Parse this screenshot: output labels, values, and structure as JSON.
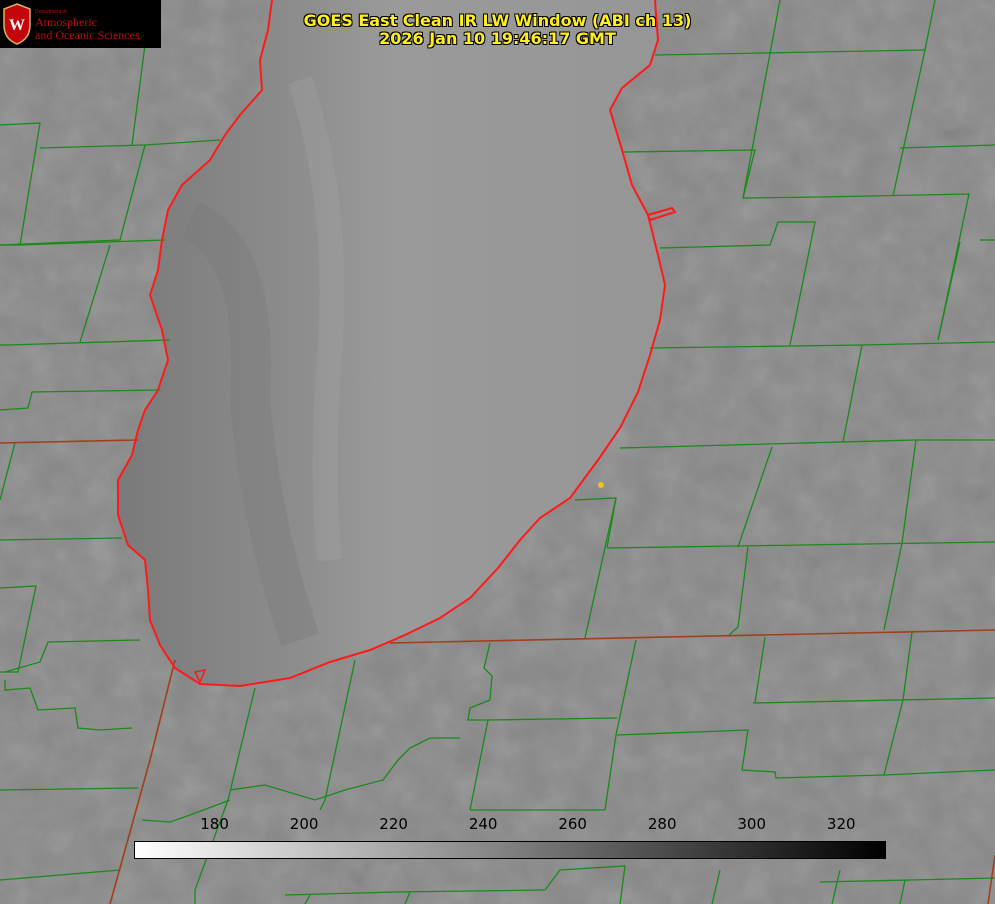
{
  "title": {
    "line1": "GOES East Clean IR LW Window (ABI ch 13)",
    "line2": "2026 Jan 10 19:46:17 GMT"
  },
  "logo": {
    "dept": "Department of",
    "line1": "Atmospheric",
    "line2": "and Oceanic Sciences",
    "crest_letter": "W"
  },
  "colorbar": {
    "ticks": [
      "180",
      "200",
      "220",
      "240",
      "260",
      "280",
      "300",
      "320"
    ],
    "tick_values": [
      180,
      200,
      220,
      240,
      260,
      280,
      300,
      320
    ],
    "range": [
      162,
      330
    ],
    "gradient": [
      "#ffffff",
      "#000000"
    ]
  },
  "colors": {
    "background": "#8a8a8a",
    "county_lines": "#1a8a1a",
    "state_lines": "#a0401a",
    "coastline": "#ff1a1a",
    "title_text": "#ffee22",
    "logo_text": "#c5050c",
    "marker": "#e8c81a"
  }
}
